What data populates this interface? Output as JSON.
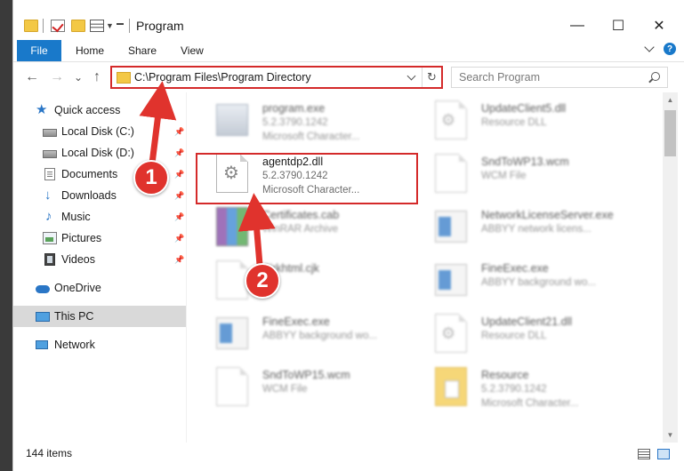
{
  "window": {
    "title": "Program",
    "controls": {
      "minimize": "—",
      "maximize": "☐",
      "close": "✕"
    }
  },
  "ribbon": {
    "tabs": [
      {
        "label": "File"
      },
      {
        "label": "Home"
      },
      {
        "label": "Share"
      },
      {
        "label": "View"
      }
    ],
    "help": "?"
  },
  "nav": {
    "back": "←",
    "forward": "→",
    "recent": "⌄",
    "up": "↑",
    "address": "C:\\Program Files\\Program Directory",
    "refresh": "↻",
    "search_placeholder": "Search Program"
  },
  "sidebar": {
    "items": [
      {
        "label": "Quick access",
        "icon": "quick-access-star-icon"
      },
      {
        "label": "Local Disk (C:)",
        "icon": "local-disk-icon",
        "pinned": true
      },
      {
        "label": "Local Disk (D:)",
        "icon": "local-disk-icon",
        "pinned": true
      },
      {
        "label": "Documents",
        "icon": "documents-icon",
        "pinned": true
      },
      {
        "label": "Downloads",
        "icon": "downloads-icon",
        "pinned": true
      },
      {
        "label": "Music",
        "icon": "music-icon",
        "pinned": true
      },
      {
        "label": "Pictures",
        "icon": "pictures-icon",
        "pinned": true
      },
      {
        "label": "Videos",
        "icon": "videos-icon",
        "pinned": true
      },
      {
        "label": "OneDrive",
        "icon": "onedrive-icon"
      },
      {
        "label": "This PC",
        "icon": "this-pc-icon",
        "selected": true
      },
      {
        "label": "Network",
        "icon": "network-icon"
      }
    ]
  },
  "files": [
    {
      "name": "program.exe",
      "line1": "5.2.3790.1242",
      "line2": "Microsoft Character...",
      "icon": "program-exe-icon",
      "blurred": true
    },
    {
      "name": "UpdateClient5.dll",
      "line1": "Resource DLL",
      "line2": "",
      "icon": "dll-file-icon",
      "blurred": true
    },
    {
      "name": "agentdp2.dll",
      "line1": "5.2.3790.1242",
      "line2": "Microsoft Character...",
      "icon": "dll-gear-icon",
      "blurred": false
    },
    {
      "name": "SndToWP13.wcm",
      "line1": "WCM File",
      "line2": "",
      "icon": "blank-file-icon",
      "blurred": true
    },
    {
      "name": "Certificates.cab",
      "line1": "WinRAR Archive",
      "line2": "",
      "icon": "winrar-archive-icon",
      "blurred": true
    },
    {
      "name": "NetworkLicenseServer.exe",
      "line1": "ABBYY network licens...",
      "line2": "",
      "icon": "exe-window-icon",
      "blurred": true
    },
    {
      "name": "Sirkhtml.cjk",
      "line1": "",
      "line2": "",
      "icon": "blank-file-icon",
      "blurred": true
    },
    {
      "name": "FineExec.exe",
      "line1": "ABBYY background wo...",
      "line2": "",
      "icon": "exe-window-icon",
      "blurred": true
    },
    {
      "name": "FineExec.exe",
      "line1": "ABBYY background wo...",
      "line2": "",
      "icon": "exe-window-icon",
      "blurred": true
    },
    {
      "name": "UpdateClient21.dll",
      "line1": "Resource DLL",
      "line2": "",
      "icon": "dll-file-icon",
      "blurred": true
    },
    {
      "name": "SndToWP15.wcm",
      "line1": "WCM File",
      "line2": "",
      "icon": "blank-file-icon",
      "blurred": true
    },
    {
      "name": "Resource",
      "line1": "5.2.3790.1242",
      "line2": "Microsoft Character...",
      "icon": "resource-folder-icon",
      "blurred": true
    }
  ],
  "status": {
    "count": "144 items"
  },
  "annotations": {
    "step1": "1",
    "step2": "2",
    "accent": "#e0332d"
  }
}
